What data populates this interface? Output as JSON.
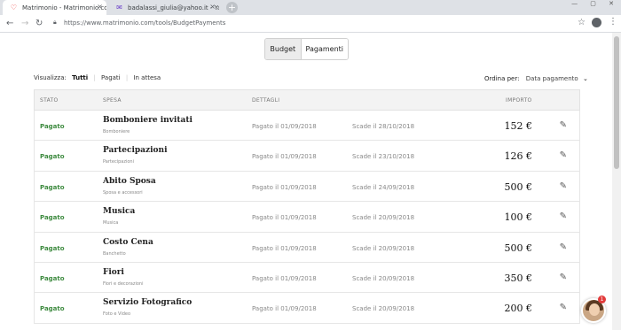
{
  "browser": {
    "tabs": [
      {
        "title": "Matrimonio - Matrimonio.com",
        "close": "×"
      },
      {
        "title": "badalassi_giulia@yahoo.it - Yaho",
        "close": "×"
      }
    ],
    "new_tab": "+",
    "url": "https://www.matrimonio.com/tools/BudgetPayments",
    "window_controls": "— ▢ ✕"
  },
  "switcher": {
    "budget": "Budget",
    "payments": "Pagamenti"
  },
  "filters": {
    "label": "Visualizza:",
    "all": "Tutti",
    "paid": "Pagati",
    "pending": "In attesa"
  },
  "sort": {
    "label": "Ordina per:",
    "value": "Data pagamento"
  },
  "table": {
    "headers": {
      "status": "STATO",
      "expense": "SPESA",
      "details": "DETTAGLI",
      "amount": "IMPORTO"
    },
    "rows": [
      {
        "status": "Pagato",
        "name": "Bomboniere invitati",
        "category": "Bomboniere",
        "paid": "Pagato il 01/09/2018",
        "due": "Scade il 28/10/2018",
        "amount": "152 €"
      },
      {
        "status": "Pagato",
        "name": "Partecipazioni",
        "category": "Partecipazioni",
        "paid": "Pagato il 01/09/2018",
        "due": "Scade il 23/10/2018",
        "amount": "126 €"
      },
      {
        "status": "Pagato",
        "name": "Abito Sposa",
        "category": "Sposa e accessori",
        "paid": "Pagato il 01/09/2018",
        "due": "Scade il 24/09/2018",
        "amount": "500 €"
      },
      {
        "status": "Pagato",
        "name": "Musica",
        "category": "Musica",
        "paid": "Pagato il 01/09/2018",
        "due": "Scade il 20/09/2018",
        "amount": "100 €"
      },
      {
        "status": "Pagato",
        "name": "Costo Cena",
        "category": "Banchetto",
        "paid": "Pagato il 01/09/2018",
        "due": "Scade il 20/09/2018",
        "amount": "500 €"
      },
      {
        "status": "Pagato",
        "name": "Fiori",
        "category": "Fiori e decorazioni",
        "paid": "Pagato il 01/09/2018",
        "due": "Scade il 20/09/2018",
        "amount": "350 €"
      },
      {
        "status": "Pagato",
        "name": "Servizio Fotografico",
        "category": "Foto e Video",
        "paid": "Pagato il 01/09/2018",
        "due": "Scade il 20/09/2018",
        "amount": "200 €"
      }
    ]
  },
  "chat": {
    "badge": "1"
  },
  "colors": {
    "paid_status": "#3d8a3f",
    "chat_badge": "#e23b3b"
  }
}
